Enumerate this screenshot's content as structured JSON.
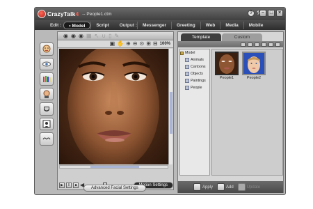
{
  "app": {
    "logo_text": "CrazyTalk",
    "logo_version": "4",
    "document_title": "-- People1.ctm"
  },
  "menu": {
    "label": "Edit :",
    "items": [
      "Model",
      "Script"
    ],
    "output_label": "Output :",
    "output_items": [
      "Messenger",
      "Greeting",
      "Web",
      "Media",
      "Mobile"
    ]
  },
  "viewer": {
    "zoom": "100%"
  },
  "playback": {
    "motion_button": "Motion Settings"
  },
  "advanced_button": "Advanced Facial Settings",
  "library": {
    "tabs": [
      "Template",
      "Custom"
    ],
    "tree": [
      "Model",
      "Animals",
      "Cartoons",
      "Objects",
      "Paintings",
      "People"
    ],
    "items": [
      "People1",
      "People2"
    ]
  },
  "actions": {
    "apply": "Apply",
    "add": "Add",
    "update": "Update"
  },
  "colors": {
    "accent": "#c8241a",
    "panel": "#d6d6d6",
    "dark_bar": "#2d2d2d"
  }
}
